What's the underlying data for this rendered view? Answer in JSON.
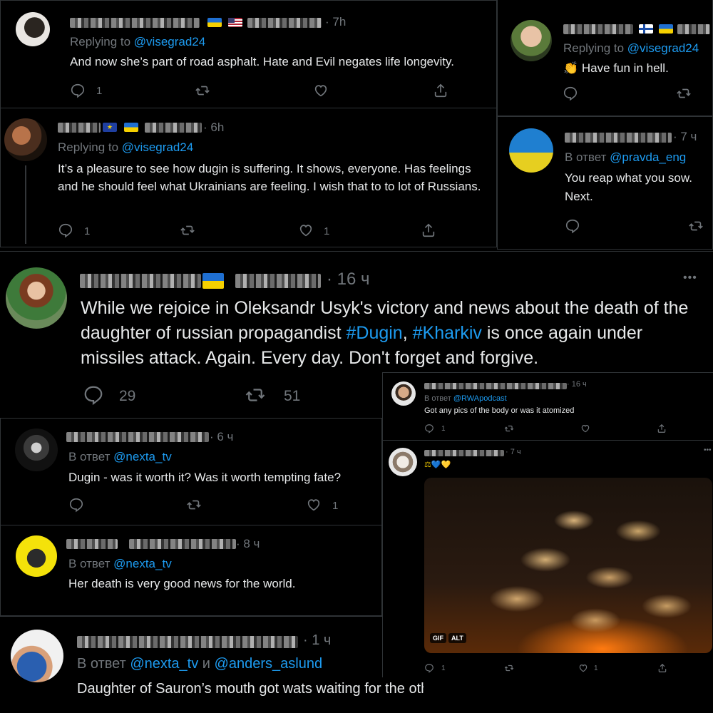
{
  "colors": {
    "background": "#000000",
    "text": "#e7e9ea",
    "muted": "#71767b",
    "link": "#1d9bf0"
  },
  "tweets": {
    "t1": {
      "time": "· 7h",
      "reply_prefix": "Replying to ",
      "reply_handle": "@visegrad24",
      "text": "And now she’s part of road asphalt. Hate and Evil negates life longevity.",
      "reply_count": "1",
      "like_count": "",
      "flags": [
        "ukraine-flag",
        "usa-flag"
      ]
    },
    "t2": {
      "time": "",
      "reply_prefix": "Replying to ",
      "reply_handle": "@visegrad24",
      "text": "Have fun in hell.",
      "emoji": "clapping-hands-icon",
      "flags": [
        "finland-flag",
        "ukraine-flag"
      ]
    },
    "t3": {
      "time": "· 6h",
      "reply_prefix": "Replying to ",
      "reply_handle": "@visegrad24",
      "text": "It’s a pleasure to see how dugin is suffering. It shows, everyone. Has feelings and he should feel what Ukrainians are feeling. I wish that to to lot of Russians.",
      "reply_count": "1",
      "like_count": "1",
      "flags": [
        "eu-flag",
        "ukraine-flag"
      ]
    },
    "t4": {
      "time": "· 7 ч",
      "reply_prefix": "В ответ ",
      "reply_handle": "@pravda_eng",
      "line1": "You reap what you sow.",
      "line2": "Next."
    },
    "t5": {
      "time": "· 16 ч",
      "more": "•••",
      "text_before": "While we rejoice in Oleksandr Usyk's victory and news about the death of the daughter of russian propagandist ",
      "hashtag1": "#Dugin",
      "text_mid": ", ",
      "hashtag2": "#Kharkiv",
      "text_after": " is once again under missiles attack. Again. Every day. Don't forget and forgive.",
      "reply_count": "29",
      "retweet_count": "51",
      "flags": [
        "ukraine-flag"
      ]
    },
    "t6": {
      "time": "· 16 ч",
      "reply_prefix": "В ответ ",
      "reply_handle": "@RWApodcast",
      "text": "Got any pics of the body or was it atomized",
      "reply_count": "1"
    },
    "t7": {
      "time": "· 7 ч",
      "emoji_line": "⚖💙💛",
      "media_badges": [
        "GIF",
        "ALT"
      ],
      "reply_count": "1",
      "like_count": "1"
    },
    "t8": {
      "time": "· 6 ч",
      "reply_prefix": "В ответ ",
      "reply_handle": "@nexta_tv",
      "text": "Dugin - was it worth it? Was it worth tempting fate?",
      "like_count": "1"
    },
    "t9": {
      "time": "· 8 ч",
      "reply_prefix": "В ответ ",
      "reply_handle": "@nexta_tv",
      "text": "Her death is very good news for the world."
    },
    "t10": {
      "time": "· 1 ч",
      "reply_prefix": "В ответ ",
      "reply_handle": "@nexta_tv",
      "reply_joiner": " и ",
      "reply_handle2": "@anders_aslund",
      "text": "Daughter of Sauron’s mouth got wats waiting for the other in Mordor."
    }
  }
}
